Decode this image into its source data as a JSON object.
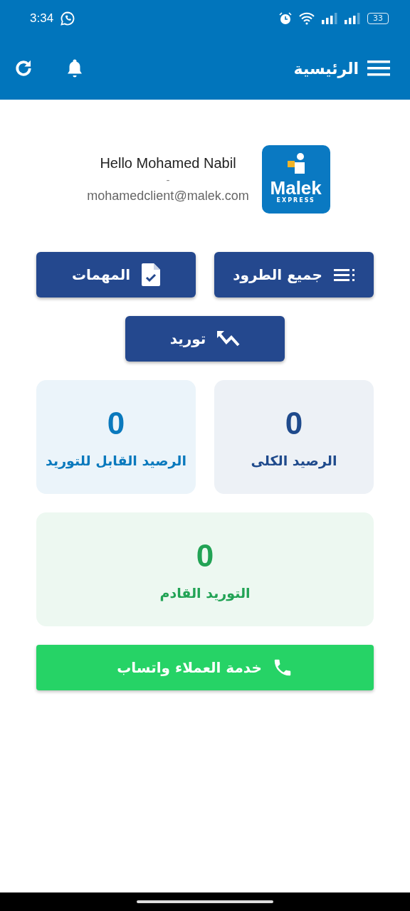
{
  "status_bar": {
    "time": "3:34",
    "battery": "33"
  },
  "app_bar": {
    "title": "الرئيسية"
  },
  "profile": {
    "greeting": "Hello Mohamed Nabil",
    "separator": "-",
    "email": "mohamedclient@malek.com",
    "logo": {
      "name": "Malek",
      "tagline": "EXPRESS"
    }
  },
  "actions": [
    {
      "label": "جميع الطرود",
      "kind": "list"
    },
    {
      "label": "المهمات",
      "kind": "task"
    },
    {
      "label": "توريد",
      "kind": "trend"
    }
  ],
  "stats": [
    {
      "value": "0",
      "label": "الرصيد الكلى",
      "color": "#1f4a8c"
    },
    {
      "value": "0",
      "label": "الرصيد القابل للتوريد",
      "color": "#0a79bd"
    },
    {
      "value": "0",
      "label": "التوريد القادم",
      "color": "#22a355"
    }
  ],
  "support_button": {
    "label": "خدمة العملاء واتساب"
  }
}
